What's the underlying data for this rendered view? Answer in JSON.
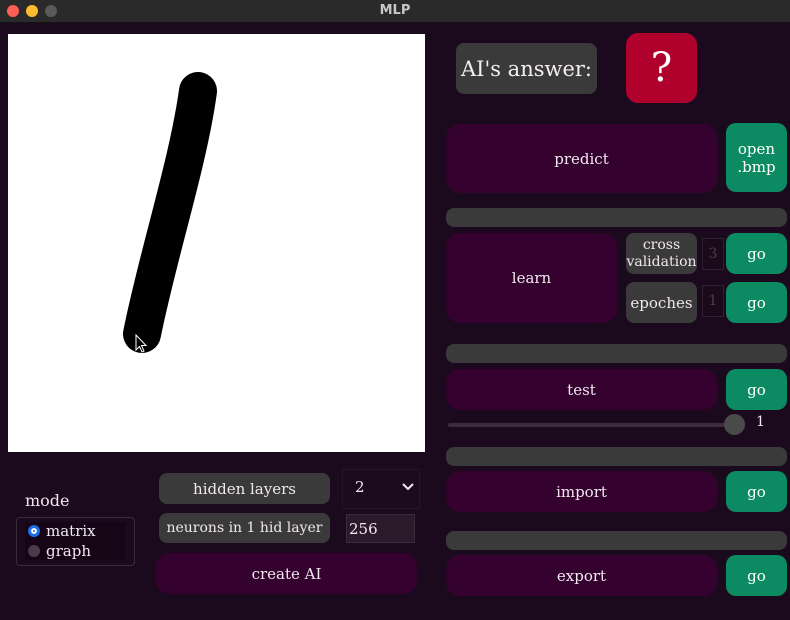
{
  "window": {
    "title": "MLP",
    "traffic_lights": {
      "close": "#ff5f57",
      "minimize": "#febc2e",
      "zoom": "#5a5a5a"
    }
  },
  "colors": {
    "background": "#1b0a1e",
    "button_purple": "#350230",
    "button_dark": "#3a3a3a",
    "button_green": "#0c8b62",
    "answer_red": "#b0002c"
  },
  "answer": {
    "label": "AI's answer:",
    "value": "?"
  },
  "predict": {
    "label": "predict",
    "open_bmp": "open\n.bmp"
  },
  "learn": {
    "label": "learn",
    "cross_validation": {
      "label": "cross\nvalidation",
      "value": "3",
      "go": "go"
    },
    "epoches": {
      "label": "epoches",
      "value": "1",
      "go": "go"
    }
  },
  "test": {
    "label": "test",
    "go": "go",
    "slider_value": "1",
    "slider_fraction": 1.0
  },
  "import": {
    "label": "import",
    "go": "go"
  },
  "export": {
    "label": "export",
    "go": "go"
  },
  "mode": {
    "title": "mode",
    "options": [
      {
        "label": "matrix",
        "selected": true
      },
      {
        "label": "graph",
        "selected": false
      }
    ]
  },
  "config": {
    "hidden_layers": {
      "label": "hidden layers",
      "value": "2"
    },
    "neurons": {
      "label": "neurons in 1 hid layer",
      "value": "256"
    },
    "create": "create AI"
  },
  "icons": {
    "select_arrow": "chevron-down-icon",
    "cursor": "mouse-cursor-icon"
  }
}
